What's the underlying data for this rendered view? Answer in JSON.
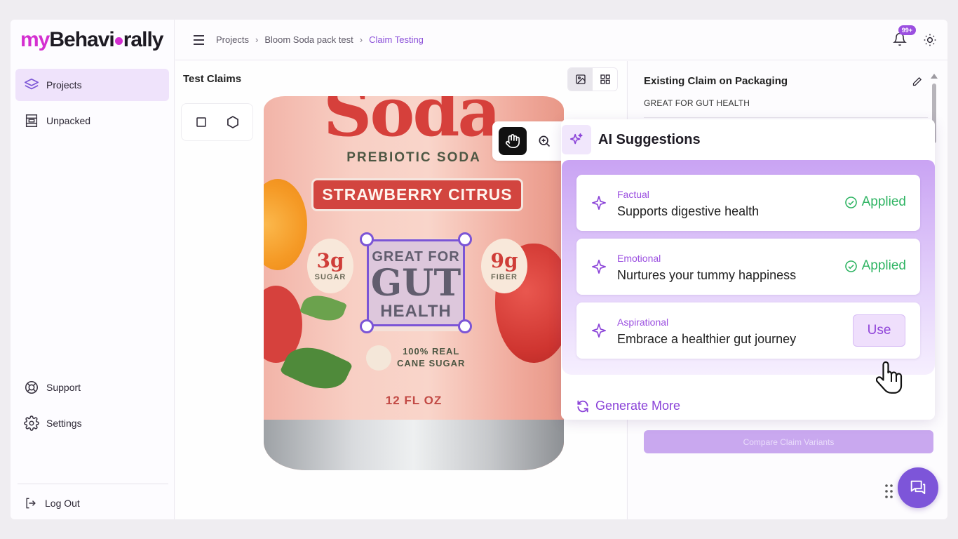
{
  "app": {
    "logo_prefix": "my",
    "logo_main_a": "Behavi",
    "logo_main_b": "rally",
    "brand_color": "#d42fd0",
    "accent_color": "#9b4fe0"
  },
  "sidebar": {
    "items": [
      {
        "label": "Projects",
        "icon": "layers-icon",
        "active": true
      },
      {
        "label": "Unpacked",
        "icon": "package-layout-icon",
        "active": false
      }
    ],
    "bottom_items": [
      {
        "label": "Support",
        "icon": "lifebuoy-icon"
      },
      {
        "label": "Settings",
        "icon": "gear-icon"
      }
    ],
    "logout_label": "Log Out"
  },
  "header": {
    "breadcrumb": [
      "Projects",
      "Bloom Soda pack test",
      "Claim Testing"
    ],
    "notifications_badge": "99+"
  },
  "center": {
    "title": "Test Claims",
    "can": {
      "brand_fragment": "Soda",
      "subtitle": "PREBIOTIC SODA",
      "flavor": "STRAWBERRY CITRUS",
      "left_stat_value": "3g",
      "left_stat_label": "SUGAR",
      "right_stat_value": "9g",
      "right_stat_label": "FIBER",
      "claim_line1": "GREAT FOR",
      "claim_line2": "GUT",
      "claim_line3": "HEALTH",
      "cane_line1": "100% REAL",
      "cane_line2": "CANE SUGAR",
      "volume": "12 FL OZ"
    }
  },
  "right_panel": {
    "existing_title": "Existing Claim on Packaging",
    "existing_text": "GREAT FOR GUT HEALTH",
    "compare_label": "Compare Claim Variants"
  },
  "ai": {
    "title": "AI Suggestions",
    "suggestions": [
      {
        "category": "Factual",
        "text": "Supports digestive health",
        "status": "Applied"
      },
      {
        "category": "Emotional",
        "text": "Nurtures your tummy happiness",
        "status": "Applied"
      },
      {
        "category": "Aspirational",
        "text": "Embrace a healthier gut journey",
        "action": "Use"
      }
    ],
    "generate_more": "Generate More"
  }
}
